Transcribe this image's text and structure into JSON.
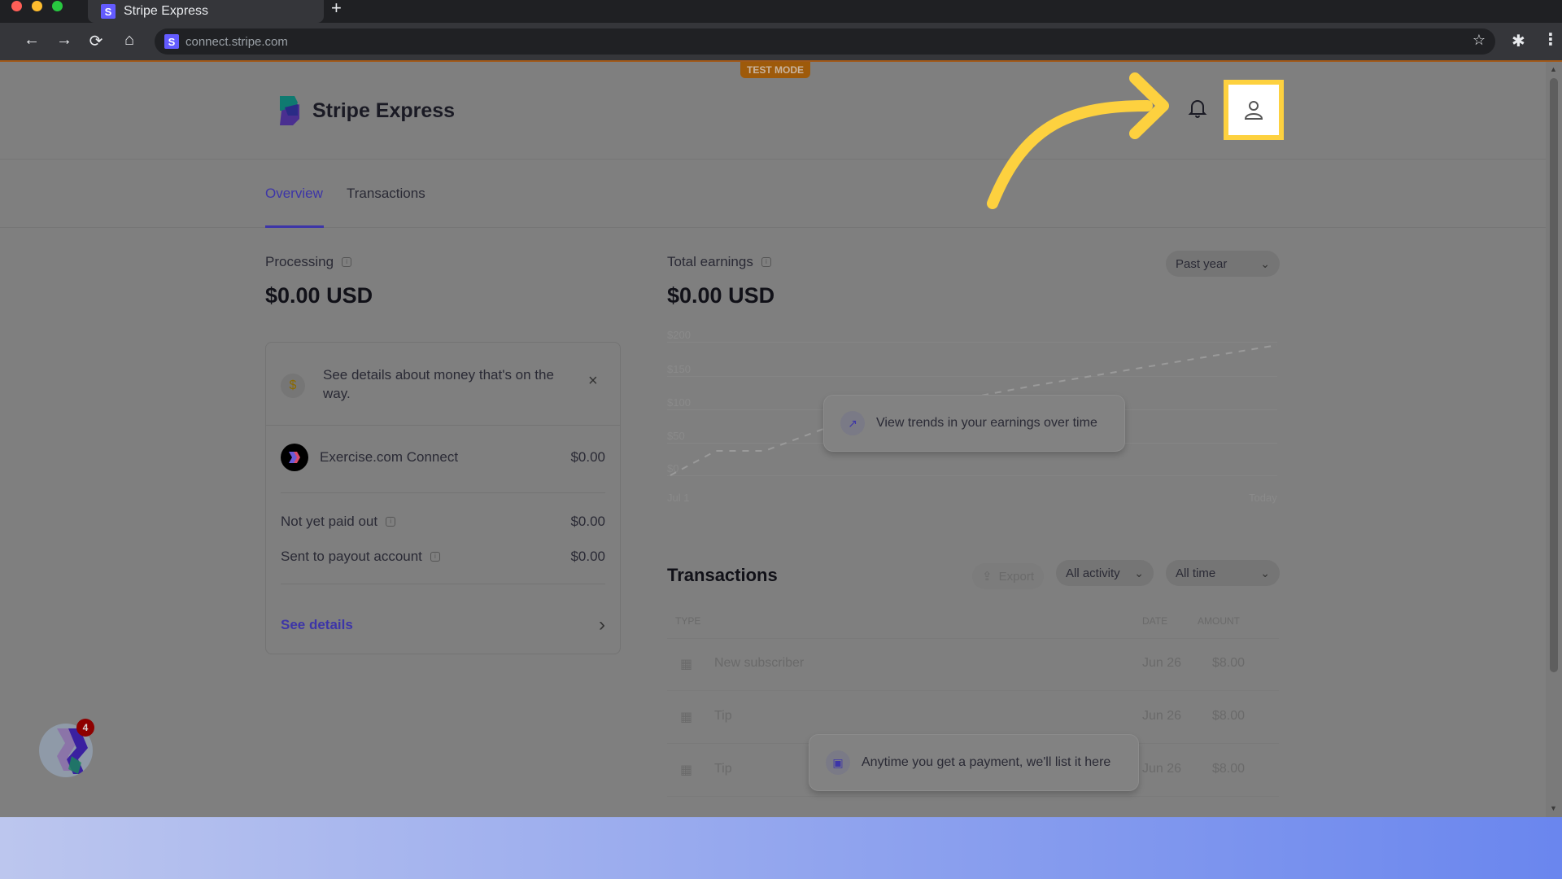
{
  "browser": {
    "tab_title": "Stripe Express",
    "tab_favicon": "S",
    "new_tab_label": "+",
    "url": "connect.stripe.com",
    "url_favicon": "S",
    "icons": {
      "back": "←",
      "forward": "→",
      "reload": "⟳",
      "home": "⌂",
      "bookmark": "☆",
      "extensions": "✱",
      "menu": "⋮"
    }
  },
  "banner": {
    "test_mode": "TEST MODE"
  },
  "header": {
    "brand": "Stripe Express",
    "bell_icon": "🔔",
    "profile_icon": "👤"
  },
  "nav": {
    "tabs": [
      {
        "label": "Overview",
        "active": true
      },
      {
        "label": "Transactions",
        "active": false
      }
    ]
  },
  "processing": {
    "label": "Processing",
    "amount": "$0.00 USD",
    "notice": "See details about money that's on the way.",
    "close_icon": "×",
    "account": {
      "name": "Exercise.com Connect",
      "amount": "$0.00"
    },
    "rows": [
      {
        "label": "Not yet paid out",
        "amount": "$0.00"
      },
      {
        "label": "Sent to payout account",
        "amount": "$0.00"
      }
    ],
    "see_details": "See details",
    "chevron": "›"
  },
  "earnings": {
    "label": "Total earnings",
    "amount": "$0.00 USD",
    "range_select": "Past year",
    "chart_ticks": [
      "$200",
      "$150",
      "$100",
      "$50",
      "$0"
    ],
    "x_start": "Jul 1",
    "x_end": "Today",
    "overlay": "View trends in your earnings over time"
  },
  "transactions": {
    "title": "Transactions",
    "export": "Export",
    "activity_select": "All activity",
    "time_select": "All time",
    "columns": {
      "type": "TYPE",
      "date": "DATE",
      "amount": "AMOUNT"
    },
    "rows": [
      {
        "type": "New subscriber",
        "date": "Jun 26",
        "amount": "$8.00"
      },
      {
        "type": "Tip",
        "date": "Jun 26",
        "amount": "$8.00"
      },
      {
        "type": "Tip",
        "date": "Jun 26",
        "amount": "$8.00"
      }
    ],
    "overlay": "Anytime you get a payment, we'll list it here"
  },
  "floating_widget": {
    "badge_count": "4"
  },
  "colors": {
    "accent": "#3d35a8",
    "highlight": "#fdd13f",
    "test_mode": "#9e5a0a"
  }
}
